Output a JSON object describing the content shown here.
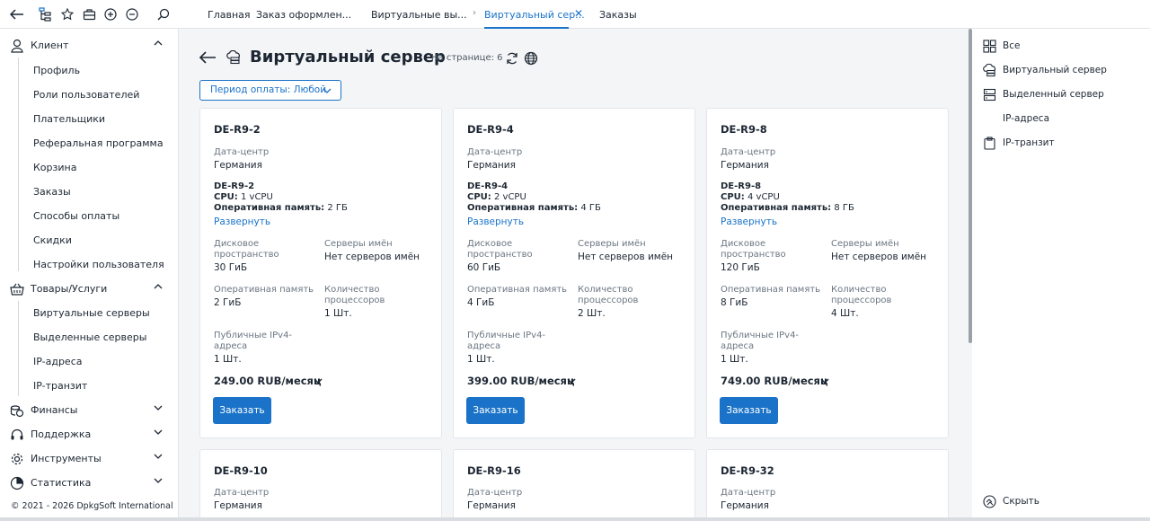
{
  "topbar": {
    "tabs": [
      {
        "label": "Главная"
      },
      {
        "label": "Заказ оформлен..."
      },
      {
        "label": "Виртуальные вы..."
      },
      {
        "label": "Виртуальный сер..."
      },
      {
        "label": "Заказы"
      }
    ]
  },
  "sidebar": {
    "groups": [
      {
        "label": "Клиент",
        "items": [
          "Профиль",
          "Роли пользователей",
          "Плательщики",
          "Реферальная программа",
          "Корзина",
          "Заказы",
          "Способы оплаты",
          "Скидки",
          "Настройки пользователя"
        ]
      },
      {
        "label": "Товары/Услуги",
        "items": [
          "Виртуальные серверы",
          "Выделенные серверы",
          "IP-адреса",
          "IP-транзит"
        ]
      },
      {
        "label": "Финансы"
      },
      {
        "label": "Поддержка"
      },
      {
        "label": "Инструменты"
      },
      {
        "label": "Статистика"
      }
    ],
    "copyright": "© 2021 - 2026 DpkgSoft International"
  },
  "main": {
    "title": "Виртуальный сервер",
    "per_page": "На странице: 6",
    "period_filter": "Период оплаты: Любой",
    "labels": {
      "datacenter": "Дата-центр",
      "disk": "Дисковое пространство",
      "nameservers": "Серверы имён",
      "ram": "Оперативная память",
      "cpu_count": "Количество процессоров",
      "ipv4": "Публичные IPv4-адреса",
      "cpu_key": "CPU:",
      "ram_key": "Оперативная память:",
      "expand": "Развернуть",
      "order": "Заказать"
    },
    "cards": [
      {
        "name": "DE-R9-2",
        "datacenter": "Германия",
        "cpu": "1 vCPU",
        "ram_short": "2 ГБ",
        "disk": "30 ГиБ",
        "nameservers": "Нет серверов имён",
        "ram": "2 ГиБ",
        "cpu_count": "1 Шт.",
        "ipv4": "1 Шт.",
        "price": "249.00 RUB/месяц"
      },
      {
        "name": "DE-R9-4",
        "datacenter": "Германия",
        "cpu": "2 vCPU",
        "ram_short": "4 ГБ",
        "disk": "60 ГиБ",
        "nameservers": "Нет серверов имён",
        "ram": "4 ГиБ",
        "cpu_count": "2 Шт.",
        "ipv4": "1 Шт.",
        "price": "399.00 RUB/месяц"
      },
      {
        "name": "DE-R9-8",
        "datacenter": "Германия",
        "cpu": "4 vCPU",
        "ram_short": "8 ГБ",
        "disk": "120 ГиБ",
        "nameservers": "Нет серверов имён",
        "ram": "8 ГиБ",
        "cpu_count": "4 Шт.",
        "ipv4": "1 Шт.",
        "price": "749.00 RUB/месяц"
      },
      {
        "name": "DE-R9-10",
        "datacenter": "Германия"
      },
      {
        "name": "DE-R9-16",
        "datacenter": "Германия"
      },
      {
        "name": "DE-R9-32",
        "datacenter": "Германия"
      }
    ]
  },
  "right_panel": {
    "items": [
      {
        "label": "Все",
        "icon": "grid-icon"
      },
      {
        "label": "Виртуальный сервер",
        "icon": "cloud-server-icon"
      },
      {
        "label": "Выделенный сервер",
        "icon": "server-icon"
      },
      {
        "label": "IP-адреса",
        "icon": ""
      },
      {
        "label": "IP-транзит",
        "icon": "clipboard-icon"
      }
    ],
    "hide_label": "Скрыть"
  },
  "colors": {
    "accent": "#1a73c8",
    "text": "#1d2733",
    "muted": "#6b7682",
    "background": "#f4f5f7"
  }
}
